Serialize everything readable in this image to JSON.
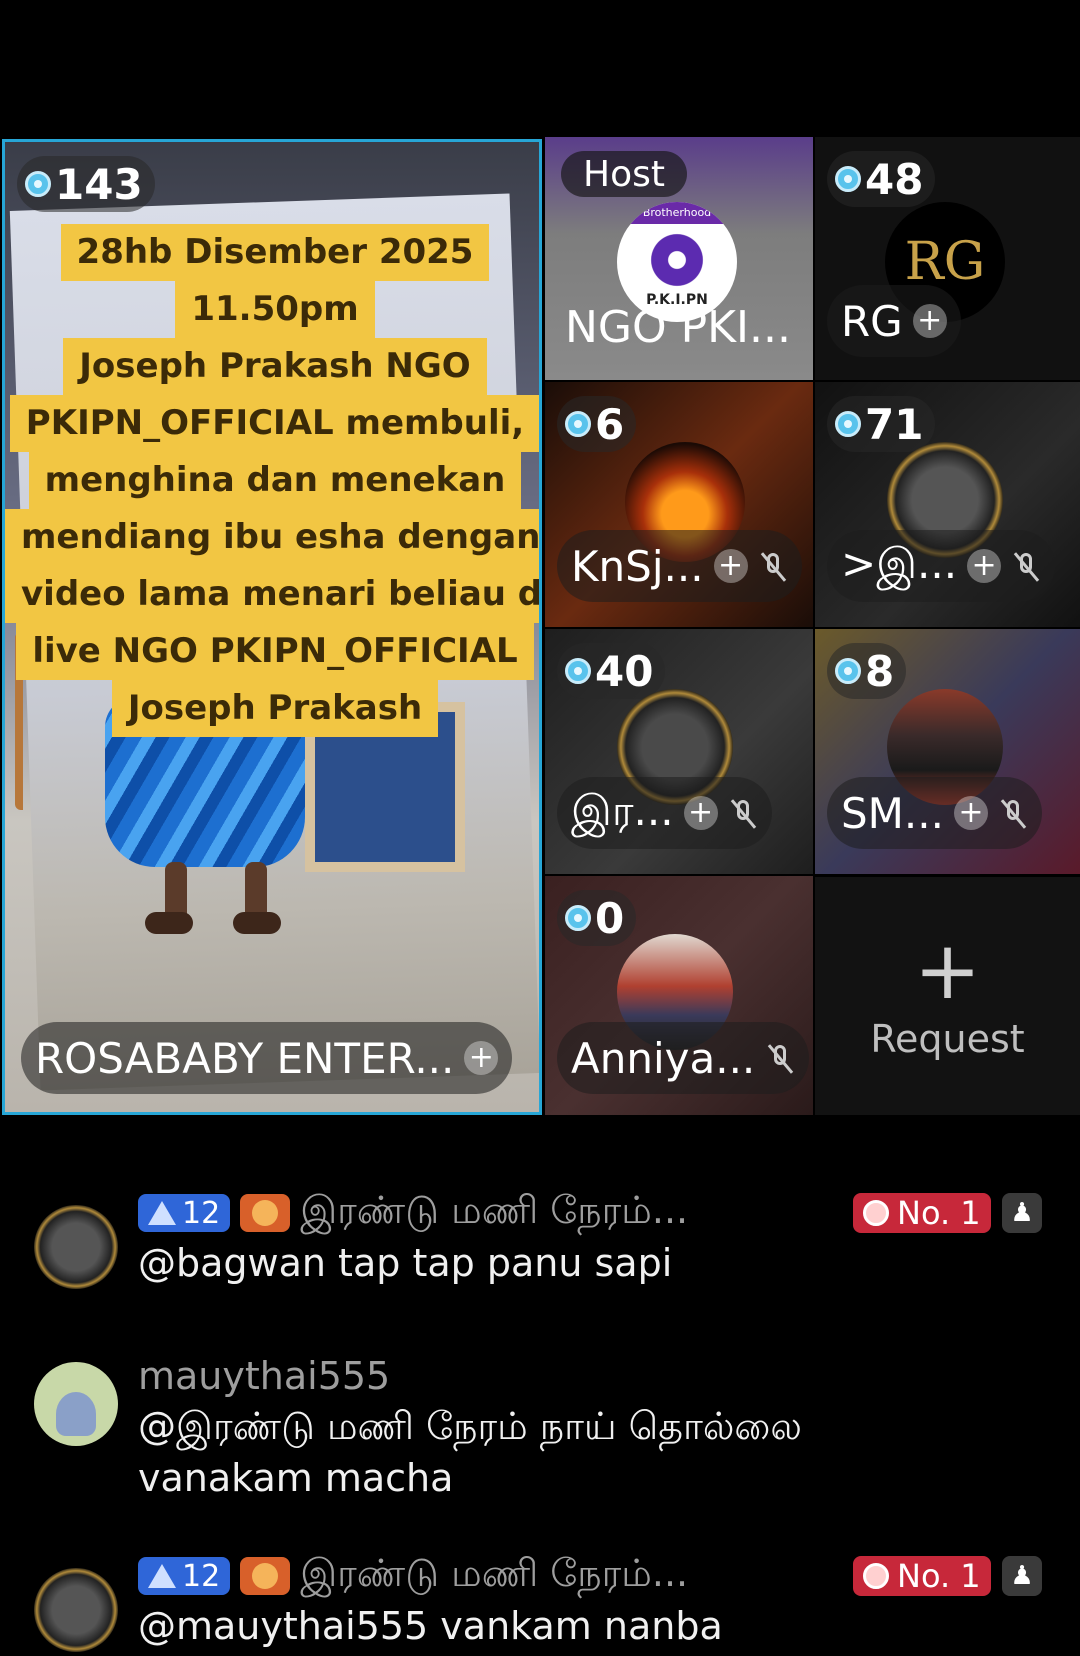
{
  "main_guest": {
    "count": "143",
    "name": "ROSABABY ENTER...",
    "caption_lines": [
      "28hb Disember 2025",
      "11.50pm",
      "Joseph Prakash NGO",
      "PKIPN_OFFICIAL membuli,",
      "menghina dan menekan",
      "mendiang ibu esha dengan",
      "video lama menari beliau di",
      "live NGO PKIPN_OFFICIAL",
      "Joseph Prakash"
    ]
  },
  "host": {
    "badge": "Host",
    "name": "NGO PKI...",
    "logo_text": "P.K.I.PN",
    "logo_top": "Brotherhood"
  },
  "guests": [
    {
      "count": "48",
      "name": "RG",
      "avatar_text": "RG"
    },
    {
      "count": "6",
      "name": "KnSj..."
    },
    {
      "count": "71",
      "name": ">இ..."
    },
    {
      "count": "40",
      "name": "இர..."
    },
    {
      "count": "8",
      "name": "SM..."
    },
    {
      "count": "0",
      "name": "Anniya..."
    }
  ],
  "request": {
    "plus": "+",
    "label": "Request"
  },
  "chat": [
    {
      "level": "12",
      "username": "இரண்டு மணி நேரம்...",
      "rank": "No. 1",
      "text": "@bagwan tap tap panu sapi"
    },
    {
      "username": "mauythai555",
      "text_line1": "@இரண்டு மணி நேரம் நாய் தொல்லை",
      "text_line2": "vanakam macha"
    },
    {
      "level": "12",
      "username": "இரண்டு மணி நேரம்...",
      "rank": "No. 1",
      "text": "@mauythai555 vankam nanba"
    }
  ],
  "colors": {
    "caption_bg": "#f2c643",
    "main_border": "#27a6d6",
    "rank_badge": "#c7283a",
    "level_badge": "#2f66d8"
  }
}
